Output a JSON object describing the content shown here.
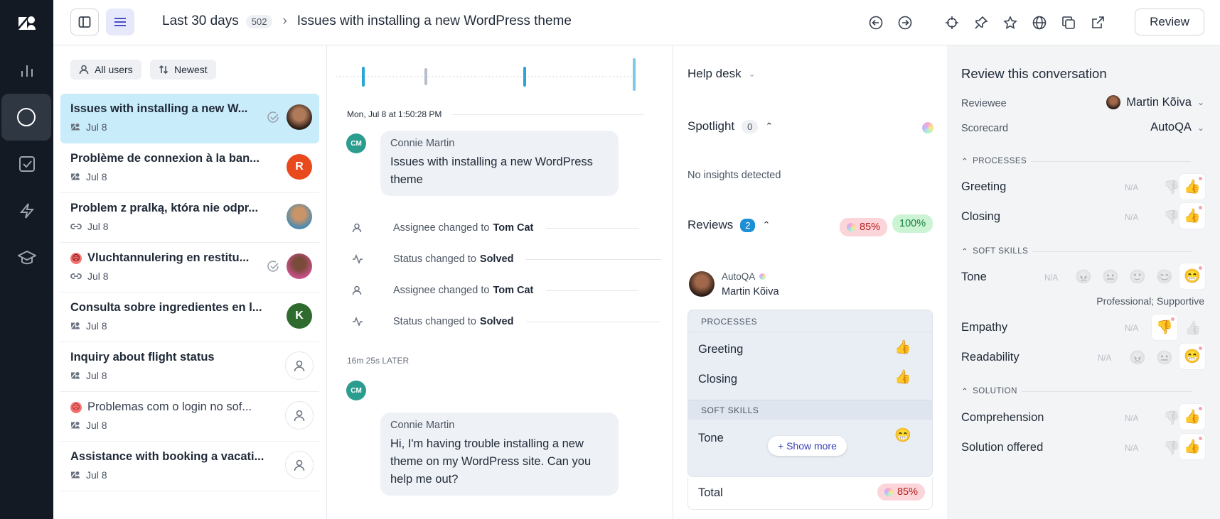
{
  "header": {
    "filter_label": "Last 30 days",
    "filter_count": "502",
    "ticket_title": "Issues with installing a new WordPress theme",
    "review_button": "Review"
  },
  "list": {
    "chips": [
      "All users",
      "Newest"
    ],
    "items": [
      {
        "title": "Issues with installing a new W...",
        "date": "Jul 8",
        "src": "zendesk",
        "avatar": "photo",
        "checked": true,
        "selected": true,
        "bold": true
      },
      {
        "title": "Problème de connexion à la ban...",
        "date": "Jul 8",
        "src": "zendesk",
        "avatar": "R",
        "avatar_color": "#e8491d",
        "bold": true
      },
      {
        "title": "Problem z pralką, która nie odpr...",
        "date": "Jul 8",
        "src": "link",
        "avatar": "photo2",
        "bold": true
      },
      {
        "title": "Vluchtannulering en restitu...",
        "date": "Jul 8",
        "src": "link",
        "avatar": "photo3",
        "checked": true,
        "sad": true,
        "bold": true
      },
      {
        "title": "Consulta sobre ingredientes en l...",
        "date": "Jul 8",
        "src": "zendesk",
        "avatar": "K",
        "avatar_color": "#2f6b2f",
        "bold": true
      },
      {
        "title": "Inquiry about flight status",
        "date": "Jul 8",
        "src": "zendesk",
        "avatar": "ghost",
        "bold": true
      },
      {
        "title": "Problemas com o login no sof...",
        "date": "Jul 8",
        "src": "zendesk",
        "avatar": "ghost",
        "sad": true,
        "bold": false
      },
      {
        "title": "Assistance with booking a vacati...",
        "date": "Jul 8",
        "src": "zendesk",
        "avatar": "ghost",
        "bold": true
      }
    ]
  },
  "conversation": {
    "timestamp": "Mon, Jul 8 at 1:50:28 PM",
    "msg1": {
      "initials": "CM",
      "name": "Connie Martin",
      "text": "Issues with installing a new WordPress theme"
    },
    "events": [
      {
        "text": "Assignee changed to",
        "value": "Tom Cat",
        "icon": "user-icon"
      },
      {
        "text": "Status changed to",
        "value": "Solved",
        "icon": "activity-icon"
      },
      {
        "text": "Assignee changed to",
        "value": "Tom Cat",
        "icon": "user-icon"
      },
      {
        "text": "Status changed to",
        "value": "Solved",
        "icon": "activity-icon"
      }
    ],
    "later": "16m 25s LATER",
    "msg2": {
      "initials": "CM",
      "name": "Connie Martin",
      "text": "Hi, I'm having trouble installing a new theme on my WordPress site. Can you help me out?"
    }
  },
  "middle": {
    "helpdesk": "Help desk",
    "spotlight": "Spotlight",
    "spotlight_count": "0",
    "no_insights": "No insights detected",
    "reviews": "Reviews",
    "reviews_count": "2",
    "score1": "85%",
    "score2": "100%",
    "reviewer": "AutoQA",
    "reviewee": "Martin Kõiva",
    "sec_processes": "PROCESSES",
    "greeting": "Greeting",
    "closing": "Closing",
    "sec_soft": "SOFT SKILLS",
    "tone": "Tone",
    "show_more": "+ Show more",
    "total": "Total",
    "total_score": "85%"
  },
  "review": {
    "title": "Review this conversation",
    "reviewee_label": "Reviewee",
    "reviewee_value": "Martin Kõiva",
    "scorecard_label": "Scorecard",
    "scorecard_value": "AutoQA",
    "sec_processes": "PROCESSES",
    "greeting": "Greeting",
    "closing": "Closing",
    "sec_soft": "SOFT SKILLS",
    "tone": "Tone",
    "tone_note": "Professional; Supportive",
    "empathy": "Empathy",
    "readability": "Readability",
    "sec_solution": "SOLUTION",
    "comprehension": "Comprehension",
    "solution_offered": "Solution offered",
    "na": "N/A"
  }
}
